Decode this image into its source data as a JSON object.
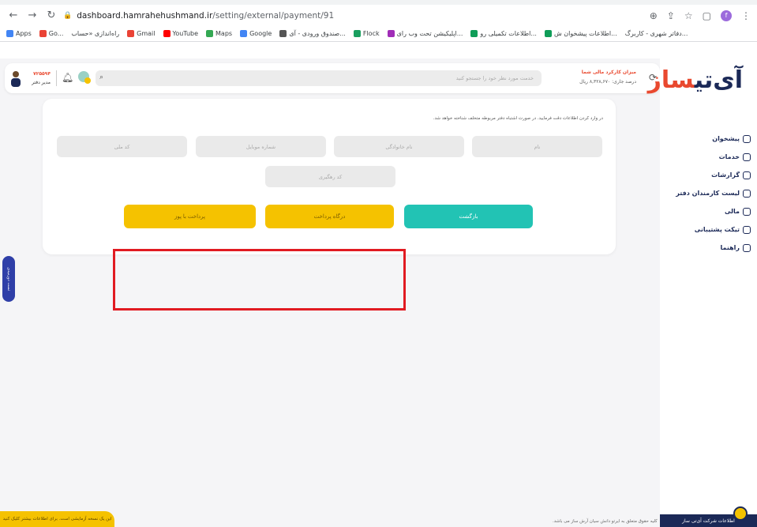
{
  "browser": {
    "url_host": "dashboard.hamrahehushmand.ir",
    "url_path": "/setting/external/payment/91",
    "profile_letter": "f",
    "bookmarks": [
      "Apps",
      "Go...",
      "راه‌اندازی «حساب",
      "Gmail",
      "YouTube",
      "Maps",
      "Google",
      "صندوق ورودی - آی...",
      "Flock",
      "اپلیکیشن تحت وب رای...",
      "اطلاعات تکمیلی رو...",
      "اطلاعات پیشخوان ش...",
      "دفاتر شهری - کاربرگ..."
    ]
  },
  "colors": {
    "brand_navy": "#1b2957",
    "brand_red": "#e9492f",
    "yellow": "#f5c200",
    "teal": "#22c3b4",
    "highlight_red": "#e11b22"
  },
  "sidebar": {
    "logo_dark": "آی‌تی",
    "logo_accent": "ساز",
    "items": [
      {
        "label": "پیشخوان",
        "icon": "home-icon"
      },
      {
        "label": "خدمات",
        "icon": "services-icon"
      },
      {
        "label": "گزارشات",
        "icon": "report-icon"
      },
      {
        "label": "لیست کارمندان دفتر",
        "icon": "users-icon"
      },
      {
        "label": "مالی",
        "icon": "wallet-icon"
      },
      {
        "label": "تیکت پشتیبانی",
        "icon": "ticket-icon"
      },
      {
        "label": "راهنما",
        "icon": "help-icon"
      }
    ],
    "footer": "اطلاعات شرکت آی‌تی ساز"
  },
  "topbar": {
    "search_placeholder": "خدمت مورد نظر خود را جستجو کنید",
    "wallet_title": "میزان کارکرد مالی شما",
    "wallet_value": "درصد جاری: ۸,۳۲۸,۶۷۰ ریال",
    "user_badge": "۷۲۵۵۹۴",
    "user_role": "مدیر دفتر"
  },
  "form": {
    "notice": "در وارد کردن اطلاعات دقت فرمایید. در صورت اشتباه دفتر مربوطه متخلف شناخته خواهد شد.",
    "fields": {
      "name": "نام",
      "family": "نام خانوادگی",
      "mobile": "شماره موبایل",
      "national_code": "کد ملی",
      "tracking": "کد رهگیری"
    },
    "buttons": {
      "back": "بازگشت",
      "gateway": "درگاه پرداخت",
      "pos": "پرداخت با پوز"
    }
  },
  "side_tab": "تست دورمیدی",
  "bottom_notice": "این یک نسخه آزمایشی است. برای اطلاعات بیشتر کلیک کنید",
  "copyright": "کلیه حقوق متعلق به ایرتو دانش سیان آرش ساز می باشد."
}
